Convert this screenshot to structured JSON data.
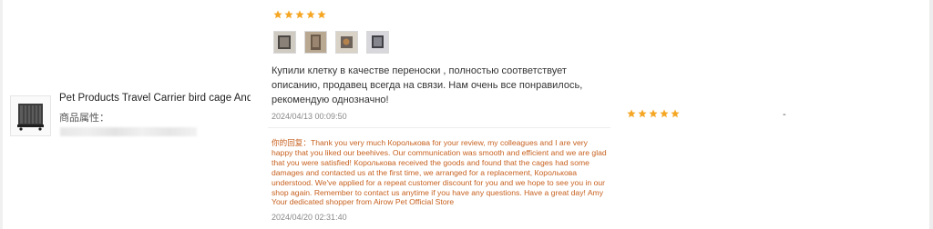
{
  "product": {
    "title": "Pet Products Travel Carrier bird cage And A...",
    "attr_label": "商品属性：",
    "image_icon": "bird-cage-icon"
  },
  "review": {
    "rating": 5,
    "photo_count": 4,
    "text": "Купили клетку в качестве переноски , полностью соответствует описанию, продавец всегда на связи. Нам очень все понравилось, рекомендую однозначно!",
    "date": "2024/04/13 00:09:50"
  },
  "reply": {
    "label": "你的回复：",
    "text": "Thank you very much Королькова for your review, my colleagues and I are very happy that you liked our beehives. Our communication was smooth and efficient and we are glad that you were satisfied! Королькова received the goods and found that the cages had some damages and contacted us at the first time, we arranged for a replacement, Королькова understood. We've applied for a repeat customer discount for you and we hope to see you in our shop again. Remember to contact us anytime if you have any questions. Have a great day! Amy Your dedicated shopper from Airow Pet Official Store",
    "date": "2024/04/20 02:31:40"
  },
  "seller_rating": 5,
  "extra_value": "-",
  "colors": {
    "star": "#f5a623",
    "reply": "#c7611f",
    "date": "#888888"
  }
}
